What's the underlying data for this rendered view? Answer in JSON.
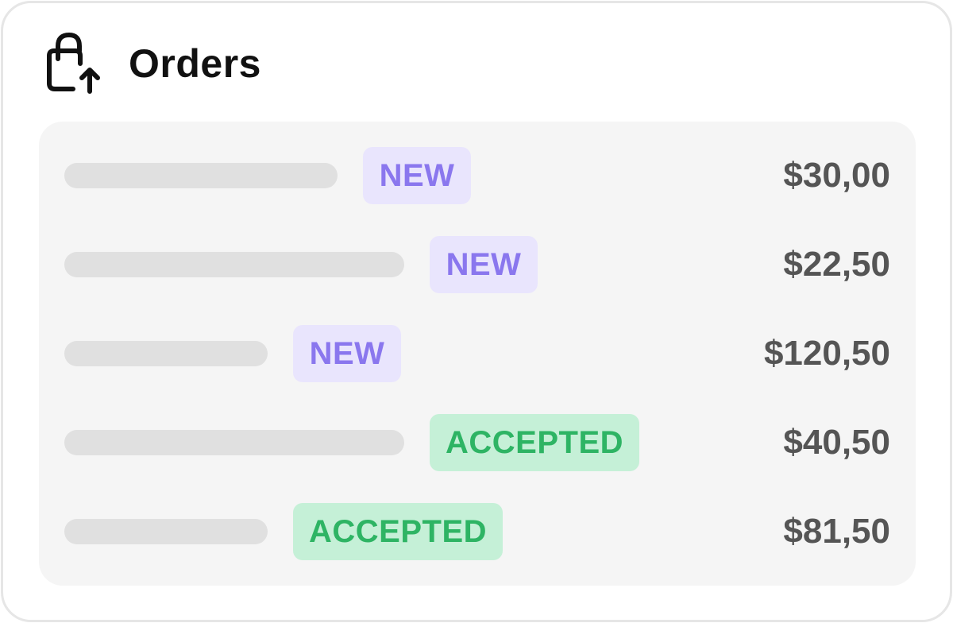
{
  "header": {
    "title": "Orders",
    "icon": "shopping-bag-upload-icon"
  },
  "orders": [
    {
      "status": "NEW",
      "status_type": "new",
      "price": "$30,00"
    },
    {
      "status": "NEW",
      "status_type": "new",
      "price": "$22,50"
    },
    {
      "status": "NEW",
      "status_type": "new",
      "price": "$120,50"
    },
    {
      "status": "ACCEPTED",
      "status_type": "accepted",
      "price": "$40,50"
    },
    {
      "status": "ACCEPTED",
      "status_type": "accepted",
      "price": "$81,50"
    }
  ],
  "colors": {
    "new_badge_bg": "#e9e5fd",
    "new_badge_text": "#8a77ee",
    "accepted_badge_bg": "#c5f0d7",
    "accepted_badge_text": "#2eb464",
    "price_text": "#555555",
    "placeholder": "#e0e0e0"
  }
}
